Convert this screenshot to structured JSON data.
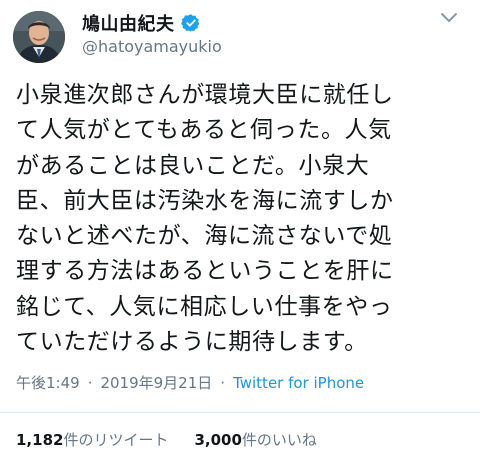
{
  "author": {
    "display_name": "鳩山由紀夫",
    "handle": "@hatoyamayukio",
    "verified": true
  },
  "tweet": {
    "lines": [
      "小泉進次郎さんが環境大臣に就任し",
      "て人気がとてもあると伺った。人気",
      "があることは良いことだ。小泉大",
      "臣、前大臣は汚染水を海に流すしか",
      "ないと述べたが、海に流さないで処",
      "理する方法はあるということを肝に",
      "銘じて、人気に相応しい仕事をやっ",
      "ていただけるように期待します。"
    ],
    "time": "午後1:49",
    "separator": "·",
    "date": "2019年9月21日",
    "source": "Twitter for iPhone"
  },
  "stats": {
    "retweets_count": "1,182",
    "retweets_label": "件のリツイート",
    "likes_count": "3,000",
    "likes_label": "件のいいね"
  },
  "colors": {
    "text": "#14171a",
    "secondary": "#657786",
    "link": "#1b95e0",
    "verified": "#1da1f2",
    "divider": "#e1e8ed"
  },
  "icons": {
    "verified": "verified-badge-icon",
    "menu": "chevron-down-icon"
  }
}
